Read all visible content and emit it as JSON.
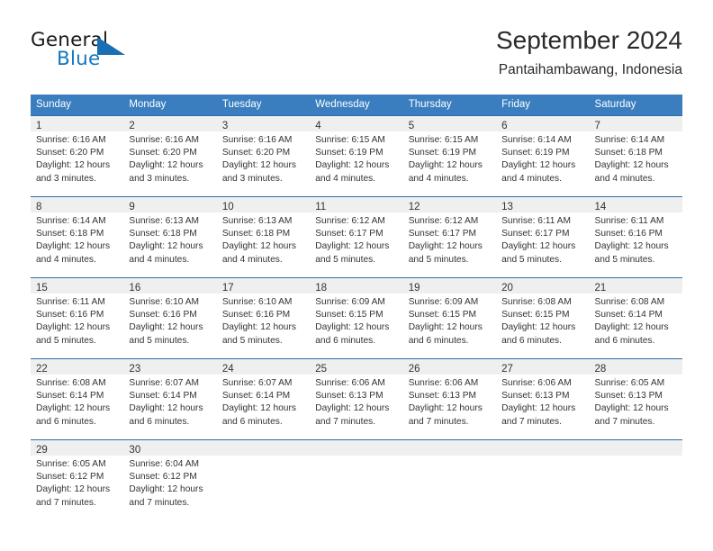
{
  "brand": {
    "name_part1": "General",
    "name_part2": "Blue",
    "accent_color": "#1278be",
    "triangle_color": "#1a6fb4"
  },
  "header": {
    "title": "September 2024",
    "subtitle": "Pantaihambawang, Indonesia"
  },
  "theme": {
    "header_row_bg": "#3a7ebf",
    "week_divider": "#2f6da8",
    "day_band_bg": "#efefef",
    "text_color": "#333333"
  },
  "weekdays": [
    "Sunday",
    "Monday",
    "Tuesday",
    "Wednesday",
    "Thursday",
    "Friday",
    "Saturday"
  ],
  "weeks": [
    [
      {
        "day": "1",
        "sunrise": "Sunrise: 6:16 AM",
        "sunset": "Sunset: 6:20 PM",
        "daylight1": "Daylight: 12 hours",
        "daylight2": "and 3 minutes."
      },
      {
        "day": "2",
        "sunrise": "Sunrise: 6:16 AM",
        "sunset": "Sunset: 6:20 PM",
        "daylight1": "Daylight: 12 hours",
        "daylight2": "and 3 minutes."
      },
      {
        "day": "3",
        "sunrise": "Sunrise: 6:16 AM",
        "sunset": "Sunset: 6:20 PM",
        "daylight1": "Daylight: 12 hours",
        "daylight2": "and 3 minutes."
      },
      {
        "day": "4",
        "sunrise": "Sunrise: 6:15 AM",
        "sunset": "Sunset: 6:19 PM",
        "daylight1": "Daylight: 12 hours",
        "daylight2": "and 4 minutes."
      },
      {
        "day": "5",
        "sunrise": "Sunrise: 6:15 AM",
        "sunset": "Sunset: 6:19 PM",
        "daylight1": "Daylight: 12 hours",
        "daylight2": "and 4 minutes."
      },
      {
        "day": "6",
        "sunrise": "Sunrise: 6:14 AM",
        "sunset": "Sunset: 6:19 PM",
        "daylight1": "Daylight: 12 hours",
        "daylight2": "and 4 minutes."
      },
      {
        "day": "7",
        "sunrise": "Sunrise: 6:14 AM",
        "sunset": "Sunset: 6:18 PM",
        "daylight1": "Daylight: 12 hours",
        "daylight2": "and 4 minutes."
      }
    ],
    [
      {
        "day": "8",
        "sunrise": "Sunrise: 6:14 AM",
        "sunset": "Sunset: 6:18 PM",
        "daylight1": "Daylight: 12 hours",
        "daylight2": "and 4 minutes."
      },
      {
        "day": "9",
        "sunrise": "Sunrise: 6:13 AM",
        "sunset": "Sunset: 6:18 PM",
        "daylight1": "Daylight: 12 hours",
        "daylight2": "and 4 minutes."
      },
      {
        "day": "10",
        "sunrise": "Sunrise: 6:13 AM",
        "sunset": "Sunset: 6:18 PM",
        "daylight1": "Daylight: 12 hours",
        "daylight2": "and 4 minutes."
      },
      {
        "day": "11",
        "sunrise": "Sunrise: 6:12 AM",
        "sunset": "Sunset: 6:17 PM",
        "daylight1": "Daylight: 12 hours",
        "daylight2": "and 5 minutes."
      },
      {
        "day": "12",
        "sunrise": "Sunrise: 6:12 AM",
        "sunset": "Sunset: 6:17 PM",
        "daylight1": "Daylight: 12 hours",
        "daylight2": "and 5 minutes."
      },
      {
        "day": "13",
        "sunrise": "Sunrise: 6:11 AM",
        "sunset": "Sunset: 6:17 PM",
        "daylight1": "Daylight: 12 hours",
        "daylight2": "and 5 minutes."
      },
      {
        "day": "14",
        "sunrise": "Sunrise: 6:11 AM",
        "sunset": "Sunset: 6:16 PM",
        "daylight1": "Daylight: 12 hours",
        "daylight2": "and 5 minutes."
      }
    ],
    [
      {
        "day": "15",
        "sunrise": "Sunrise: 6:11 AM",
        "sunset": "Sunset: 6:16 PM",
        "daylight1": "Daylight: 12 hours",
        "daylight2": "and 5 minutes."
      },
      {
        "day": "16",
        "sunrise": "Sunrise: 6:10 AM",
        "sunset": "Sunset: 6:16 PM",
        "daylight1": "Daylight: 12 hours",
        "daylight2": "and 5 minutes."
      },
      {
        "day": "17",
        "sunrise": "Sunrise: 6:10 AM",
        "sunset": "Sunset: 6:16 PM",
        "daylight1": "Daylight: 12 hours",
        "daylight2": "and 5 minutes."
      },
      {
        "day": "18",
        "sunrise": "Sunrise: 6:09 AM",
        "sunset": "Sunset: 6:15 PM",
        "daylight1": "Daylight: 12 hours",
        "daylight2": "and 6 minutes."
      },
      {
        "day": "19",
        "sunrise": "Sunrise: 6:09 AM",
        "sunset": "Sunset: 6:15 PM",
        "daylight1": "Daylight: 12 hours",
        "daylight2": "and 6 minutes."
      },
      {
        "day": "20",
        "sunrise": "Sunrise: 6:08 AM",
        "sunset": "Sunset: 6:15 PM",
        "daylight1": "Daylight: 12 hours",
        "daylight2": "and 6 minutes."
      },
      {
        "day": "21",
        "sunrise": "Sunrise: 6:08 AM",
        "sunset": "Sunset: 6:14 PM",
        "daylight1": "Daylight: 12 hours",
        "daylight2": "and 6 minutes."
      }
    ],
    [
      {
        "day": "22",
        "sunrise": "Sunrise: 6:08 AM",
        "sunset": "Sunset: 6:14 PM",
        "daylight1": "Daylight: 12 hours",
        "daylight2": "and 6 minutes."
      },
      {
        "day": "23",
        "sunrise": "Sunrise: 6:07 AM",
        "sunset": "Sunset: 6:14 PM",
        "daylight1": "Daylight: 12 hours",
        "daylight2": "and 6 minutes."
      },
      {
        "day": "24",
        "sunrise": "Sunrise: 6:07 AM",
        "sunset": "Sunset: 6:14 PM",
        "daylight1": "Daylight: 12 hours",
        "daylight2": "and 6 minutes."
      },
      {
        "day": "25",
        "sunrise": "Sunrise: 6:06 AM",
        "sunset": "Sunset: 6:13 PM",
        "daylight1": "Daylight: 12 hours",
        "daylight2": "and 7 minutes."
      },
      {
        "day": "26",
        "sunrise": "Sunrise: 6:06 AM",
        "sunset": "Sunset: 6:13 PM",
        "daylight1": "Daylight: 12 hours",
        "daylight2": "and 7 minutes."
      },
      {
        "day": "27",
        "sunrise": "Sunrise: 6:06 AM",
        "sunset": "Sunset: 6:13 PM",
        "daylight1": "Daylight: 12 hours",
        "daylight2": "and 7 minutes."
      },
      {
        "day": "28",
        "sunrise": "Sunrise: 6:05 AM",
        "sunset": "Sunset: 6:13 PM",
        "daylight1": "Daylight: 12 hours",
        "daylight2": "and 7 minutes."
      }
    ],
    [
      {
        "day": "29",
        "sunrise": "Sunrise: 6:05 AM",
        "sunset": "Sunset: 6:12 PM",
        "daylight1": "Daylight: 12 hours",
        "daylight2": "and 7 minutes."
      },
      {
        "day": "30",
        "sunrise": "Sunrise: 6:04 AM",
        "sunset": "Sunset: 6:12 PM",
        "daylight1": "Daylight: 12 hours",
        "daylight2": "and 7 minutes."
      },
      {
        "day": "",
        "sunrise": "",
        "sunset": "",
        "daylight1": "",
        "daylight2": ""
      },
      {
        "day": "",
        "sunrise": "",
        "sunset": "",
        "daylight1": "",
        "daylight2": ""
      },
      {
        "day": "",
        "sunrise": "",
        "sunset": "",
        "daylight1": "",
        "daylight2": ""
      },
      {
        "day": "",
        "sunrise": "",
        "sunset": "",
        "daylight1": "",
        "daylight2": ""
      },
      {
        "day": "",
        "sunrise": "",
        "sunset": "",
        "daylight1": "",
        "daylight2": ""
      }
    ]
  ]
}
